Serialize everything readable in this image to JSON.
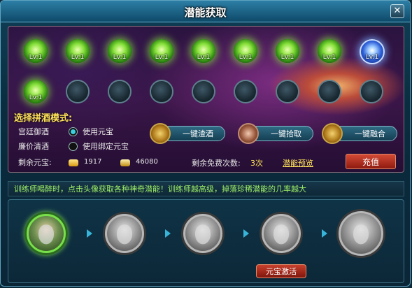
{
  "window": {
    "title": "潜能获取",
    "close_glyph": "✕"
  },
  "orbs": {
    "row1": [
      {
        "type": "green",
        "label": "Lv:1"
      },
      {
        "type": "green",
        "label": "Lv:1"
      },
      {
        "type": "green",
        "label": "Lv:1"
      },
      {
        "type": "green",
        "label": "Lv:1"
      },
      {
        "type": "green",
        "label": "Lv:1"
      },
      {
        "type": "green",
        "label": "Lv:1"
      },
      {
        "type": "green",
        "label": "Lv:1"
      },
      {
        "type": "green",
        "label": "Lv:1"
      },
      {
        "type": "blue",
        "label": "Lv:1"
      }
    ],
    "row2": [
      {
        "type": "green",
        "label": "Lv:1"
      },
      {
        "type": "empty",
        "label": ""
      },
      {
        "type": "empty",
        "label": ""
      },
      {
        "type": "empty",
        "label": ""
      },
      {
        "type": "empty",
        "label": ""
      },
      {
        "type": "empty",
        "label": ""
      },
      {
        "type": "empty",
        "label": ""
      },
      {
        "type": "empty",
        "label": ""
      },
      {
        "type": "empty",
        "label": ""
      }
    ]
  },
  "mode": {
    "title": "选择拼酒模式:",
    "options": [
      {
        "name": "宫廷御酒",
        "choice": "使用元宝",
        "selected": true
      },
      {
        "name": "廉价清酒",
        "choice": "使用绑定元宝",
        "selected": false
      }
    ]
  },
  "actions": [
    {
      "label": "一键渣酒"
    },
    {
      "label": "一键拾取"
    },
    {
      "label": "一键融合"
    }
  ],
  "currency": {
    "label": "剩余元宝:",
    "yuanbao": "1917",
    "bound_yuanbao": "46080"
  },
  "free": {
    "label": "剩余免费次数:",
    "value": "3次",
    "preview_link": "潜能预览"
  },
  "charge_button": "充值",
  "info_text": "训练师喝醉时，点击头像获取各种神奇潜能！训练师越高级，掉落珍稀潜能的几率越大",
  "activate_button": "元宝激活",
  "colors": {
    "accent_green": "#9ff066",
    "title_yellow": "#ffe35a",
    "charge_red": "#c9402c"
  }
}
